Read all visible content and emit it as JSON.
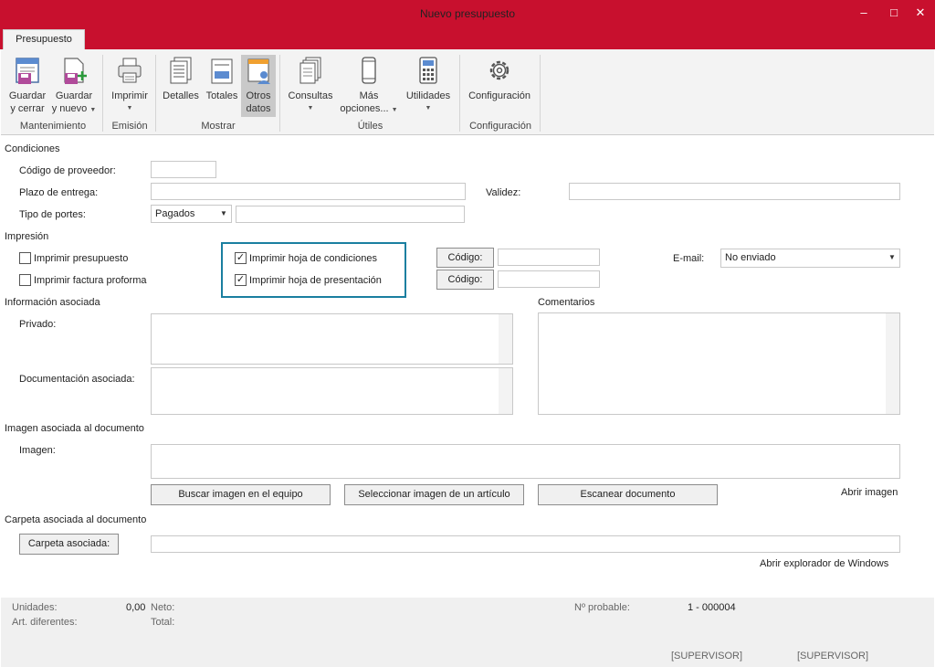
{
  "window": {
    "title": "Nuevo presupuesto",
    "controls": [
      "–",
      "□",
      "✕"
    ]
  },
  "tab": "Presupuesto",
  "ribbon": {
    "guardar_cerrar": [
      "Guardar",
      "y cerrar"
    ],
    "guardar_nuevo": [
      "Guardar",
      "y nuevo"
    ],
    "imprimir": "Imprimir",
    "detalles": "Detalles",
    "totales": "Totales",
    "otros_datos": [
      "Otros",
      "datos"
    ],
    "consultas": "Consultas",
    "mas_opciones": [
      "Más",
      "opciones..."
    ],
    "utilidades": "Utilidades",
    "configuracion": "Configuración",
    "groups": {
      "mantenimiento": "Mantenimiento",
      "emision": "Emisión",
      "mostrar": "Mostrar",
      "utiles": "Útiles",
      "configuracion": "Configuración"
    }
  },
  "condiciones": {
    "title": "Condiciones",
    "codigo_proveedor": "Código de proveedor:",
    "plazo_entrega": "Plazo de entrega:",
    "validez": "Validez:",
    "tipo_portes": "Tipo de portes:",
    "tipo_portes_value": "Pagados"
  },
  "impresion": {
    "title": "Impresión",
    "imprimir_presupuesto": "Imprimir presupuesto",
    "imprimir_factura": "Imprimir factura proforma",
    "hoja_condiciones": "Imprimir hoja de condiciones",
    "hoja_presentacion": "Imprimir hoja de presentación",
    "codigo1": "Código:",
    "codigo2": "Código:",
    "email": "E-mail:",
    "email_value": "No enviado",
    "checks": {
      "presupuesto": false,
      "factura": false,
      "condiciones": true,
      "presentacion": true
    }
  },
  "info": {
    "title": "Información asociada",
    "privado": "Privado:",
    "documentacion": "Documentación asociada:",
    "comentarios": "Comentarios"
  },
  "imagen": {
    "title": "Imagen asociada al documento",
    "imagen": "Imagen:",
    "buscar": "Buscar imagen en el equipo",
    "seleccionar": "Seleccionar imagen de un artículo",
    "escanear": "Escanear documento",
    "abrir": "Abrir imagen"
  },
  "carpeta": {
    "title": "Carpeta asociada al documento",
    "boton": "Carpeta asociada:",
    "abrir": "Abrir explorador de Windows"
  },
  "footer": {
    "unidades": "Unidades:",
    "unidades_value": "0,00",
    "art_diferentes": "Art. diferentes:",
    "neto": "Neto:",
    "total": "Total:",
    "n_probable": "Nº probable:",
    "n_probable_value": "1 - 000004",
    "user1": "[SUPERVISOR]",
    "user2": "[SUPERVISOR]"
  },
  "colors": {
    "accent": "#c8102e",
    "highlight_border": "#1a7fa0"
  }
}
